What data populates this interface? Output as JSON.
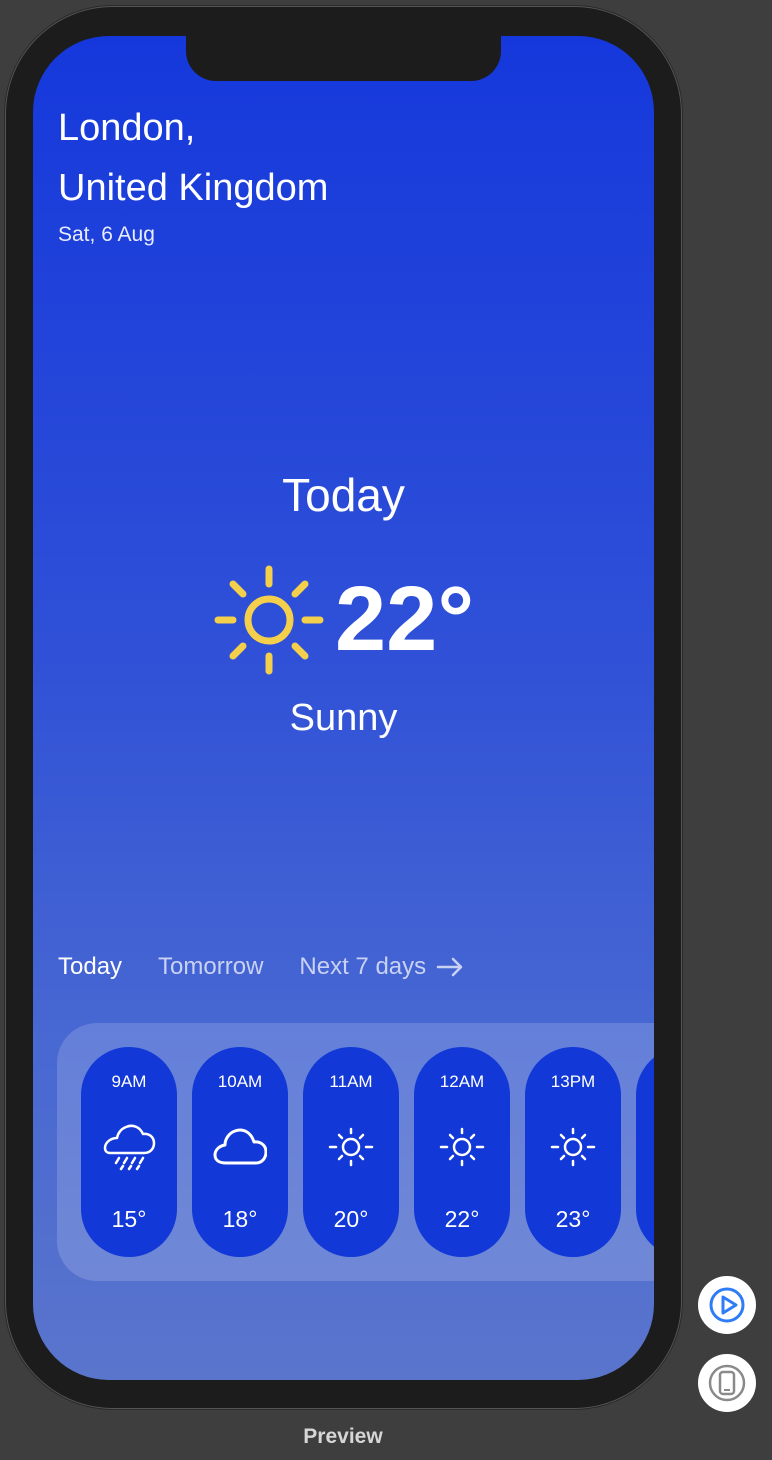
{
  "location": {
    "city": "London,",
    "country": "United Kingdom",
    "date": "Sat, 6 Aug"
  },
  "current": {
    "title": "Today",
    "temperature": "22°",
    "condition": "Sunny",
    "icon": "sun-icon"
  },
  "tabs": [
    {
      "label": "Today",
      "active": true
    },
    {
      "label": "Tomorrow",
      "active": false
    },
    {
      "label": "Next 7 days",
      "active": false,
      "icon": "arrow-right-icon"
    }
  ],
  "hourly": [
    {
      "time": "9AM",
      "temp": "15°",
      "icon": "rain-cloud-icon"
    },
    {
      "time": "10AM",
      "temp": "18°",
      "icon": "cloud-icon"
    },
    {
      "time": "11AM",
      "temp": "20°",
      "icon": "sun-icon"
    },
    {
      "time": "12AM",
      "temp": "22°",
      "icon": "sun-icon"
    },
    {
      "time": "13PM",
      "temp": "23°",
      "icon": "sun-icon"
    }
  ],
  "preview": {
    "label": "Preview",
    "buttons": [
      "play-icon",
      "device-icon"
    ]
  },
  "colors": {
    "accent_yellow": "#f4cf4b",
    "card_blue": "#1238d7",
    "screen_top": "#1538dc",
    "screen_bottom": "#5a75cc",
    "preview_button_blue": "#2f7df6"
  }
}
